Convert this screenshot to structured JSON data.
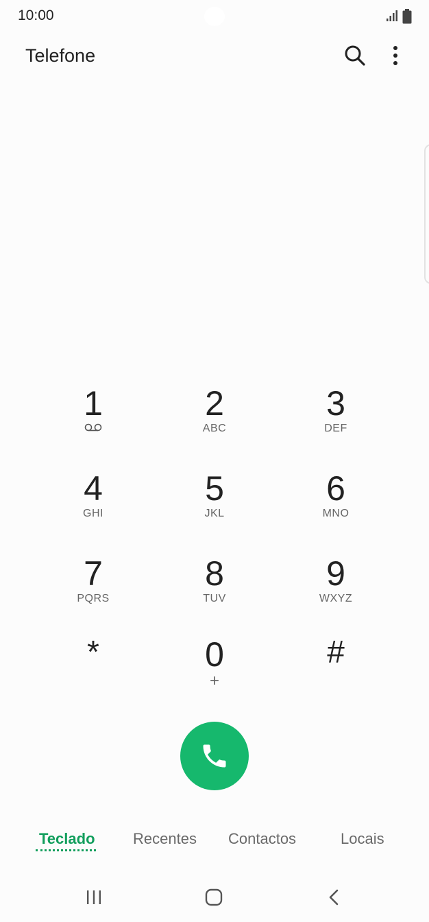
{
  "status": {
    "time": "10:00"
  },
  "header": {
    "title": "Telefone"
  },
  "keypad": [
    {
      "digit": "1",
      "letters": ""
    },
    {
      "digit": "2",
      "letters": "ABC"
    },
    {
      "digit": "3",
      "letters": "DEF"
    },
    {
      "digit": "4",
      "letters": "GHI"
    },
    {
      "digit": "5",
      "letters": "JKL"
    },
    {
      "digit": "6",
      "letters": "MNO"
    },
    {
      "digit": "7",
      "letters": "PQRS"
    },
    {
      "digit": "8",
      "letters": "TUV"
    },
    {
      "digit": "9",
      "letters": "WXYZ"
    },
    {
      "digit": "*",
      "letters": ""
    },
    {
      "digit": "0",
      "letters": "+"
    },
    {
      "digit": "#",
      "letters": ""
    }
  ],
  "tabs": [
    {
      "label": "Teclado",
      "active": true
    },
    {
      "label": "Recentes",
      "active": false
    },
    {
      "label": "Contactos",
      "active": false
    },
    {
      "label": "Locais",
      "active": false
    }
  ],
  "colors": {
    "accent": "#119e5c",
    "call_button": "#16b86d"
  },
  "icons": {
    "search": "search-icon",
    "more": "more-vertical-icon",
    "call": "phone-icon",
    "voicemail": "voicemail-icon"
  }
}
